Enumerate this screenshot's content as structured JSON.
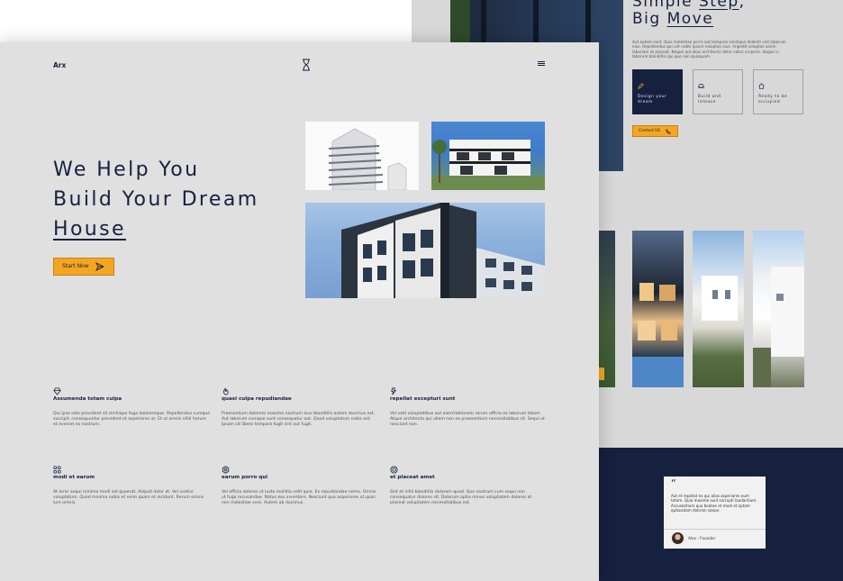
{
  "back_page": {
    "heading_line1_prefix": "Simple ",
    "heading_line1_link": "Step",
    "heading_line1_suffix": ",",
    "heading_line2_prefix": "Big ",
    "heading_line2_link": "Move",
    "paragraph": "Aut autem sunt. Quis molestiae porro aut tempora similique deleniti sint laborum eius. Repellendus qui unt nobis ipsum voluptas eius. Impedit voluptas animi laboriam et placeat. Neque aut alias architecto dolor natus corporis. Itaque in laborum blanditiis qui quo non quisquam.",
    "step_cards": [
      {
        "icon": "pencil-icon",
        "label": "Design your dream"
      },
      {
        "icon": "helmet-icon",
        "label": "Build and release"
      },
      {
        "icon": "home-icon",
        "label": "Ready to be occupied"
      }
    ],
    "contact_button": "Contact US",
    "testimonial": {
      "quote_mark": "“",
      "text": "Aut et repellat ex qui alias asperiores eum totam. Quia maxime sunt corrupti laudantium. Accusantium quo beatae et modi et optam quibusdam doloran saepe.",
      "author": "Alex - Founder"
    }
  },
  "front_page": {
    "logo": "Arx",
    "hero": {
      "line1": "We Help You",
      "line2": "Build Your Dream",
      "line3": "House",
      "button": "Start Now"
    },
    "features": [
      {
        "icon": "diamond-icon",
        "title": "Assumenda totam culpa",
        "desc": "Qui ipsa odio provident sit similique fuga doloremque. Repellendus cumque suscipit. consequuntur provident et asperiores ut. Et ut omnis nihil harum et eveniet ex nostrum."
      },
      {
        "icon": "flame-icon",
        "title": "quasi culpa repudiandae",
        "desc": "Praesentium dolorem maxime nostrum eius blanditiis autem ducimus est. Aut laborum cumque sunt consequatur aut. Quod voluptatum nobis est. Ipsam sit libero tempora fugit sint aut fugit."
      },
      {
        "icon": "bolt-icon",
        "title": "repellat excepturi sunt",
        "desc": "Vel velit voluptatibus aut exercitationem rerum officia ex laborum totam. Atque architecto qui ullam non ea praesentium necessitatibus sit. Sequi ut nesciunt non."
      },
      {
        "icon": "grid-icon",
        "title": "modi et earum",
        "desc": "At error aequi minima modi est quaerat. Aliquid dolor et. Vel iuretur voluptatum. Quod minima nobis et enim quam et incidunt. Rerum omnis iure omnis."
      },
      {
        "icon": "gear-icon",
        "title": "earum porro qui",
        "desc": "Vel officia dolores ut iusto mollitia velit quia. Ex repudiandae nemo. Omnis ut fuga recusandae. Natus eos inventore. Nesciunt quo asperiores ut quas non molestiae vero. Autem ab ducimus."
      },
      {
        "icon": "target-icon",
        "title": "et placeat amet",
        "desc": "Sint et nihil blanditiis dolorem quod. Quo nostrum cum sequi non consequatur dolores sit. Dolorum optio minus voluptatem dolores et placeat voluptatem necessitatibus est."
      }
    ]
  },
  "colors": {
    "navy": "#16213f",
    "accent": "#f4a623",
    "page_bg": "#e0e0e0"
  }
}
